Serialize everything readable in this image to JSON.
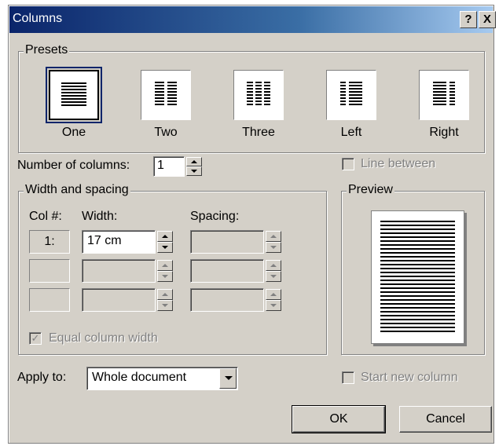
{
  "window": {
    "title": "Columns",
    "help_label": "?",
    "close_label": "X"
  },
  "presets": {
    "group_label": "Presets",
    "items": [
      {
        "label": "One",
        "icon": "one-column-icon"
      },
      {
        "label": "Two",
        "icon": "two-columns-icon"
      },
      {
        "label": "Three",
        "icon": "three-columns-icon"
      },
      {
        "label": "Left",
        "icon": "left-column-icon"
      },
      {
        "label": "Right",
        "icon": "right-column-icon"
      }
    ],
    "selected": "One"
  },
  "number_of_columns": {
    "label": "Number of columns:",
    "value": "1"
  },
  "line_between": {
    "label": "Line between",
    "checked": false,
    "enabled": false
  },
  "width_spacing": {
    "group_label": "Width and spacing",
    "col_header": "Col #:",
    "width_header": "Width:",
    "spacing_header": "Spacing:",
    "rows": [
      {
        "col": "1:",
        "width": "17 cm",
        "spacing": ""
      },
      {
        "col": "",
        "width": "",
        "spacing": ""
      },
      {
        "col": "",
        "width": "",
        "spacing": ""
      }
    ],
    "equal_width": {
      "label": "Equal column width",
      "checked": true,
      "enabled": false
    }
  },
  "preview": {
    "group_label": "Preview"
  },
  "apply_to": {
    "label": "Apply to:",
    "value": "Whole document"
  },
  "start_new_column": {
    "label": "Start new column",
    "checked": false,
    "enabled": false
  },
  "buttons": {
    "ok": "OK",
    "cancel": "Cancel"
  },
  "colors": {
    "face": "#d4d0c8",
    "titlebar_start": "#0a246a",
    "titlebar_end": "#a6caf0",
    "disabled_text": "#808080"
  }
}
